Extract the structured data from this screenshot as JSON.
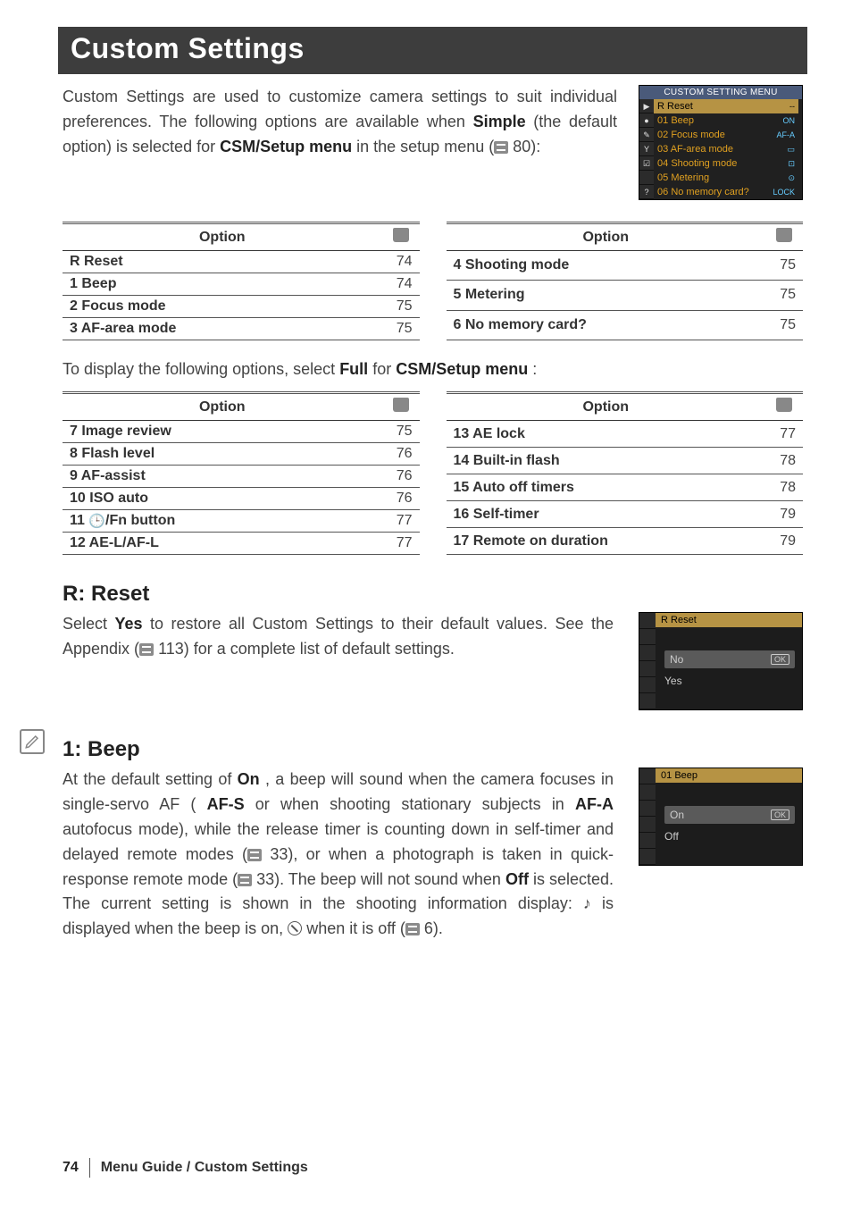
{
  "title": "Custom Settings",
  "intro": {
    "part1": "Custom Settings are used to customize camera settings to suit individual preferences.  The following options are available when ",
    "bold1": "Simple",
    "part2": " (the default option) is selected for ",
    "bold2": "CSM/Setup menu",
    "part3": " in the setup menu (",
    "ref": " 80):"
  },
  "menu_thumb": {
    "header": "CUSTOM SETTING MENU",
    "items": [
      {
        "num": "R",
        "label": "Reset",
        "val": "--",
        "sel": true
      },
      {
        "num": "01",
        "label": "Beep",
        "val": "ON"
      },
      {
        "num": "02",
        "label": "Focus mode",
        "val": "AF-A"
      },
      {
        "num": "03",
        "label": "AF-area mode",
        "val": "▭"
      },
      {
        "num": "04",
        "label": "Shooting mode",
        "val": "⊡"
      },
      {
        "num": "05",
        "label": "Metering",
        "val": "⊙"
      },
      {
        "num": "06",
        "label": "No memory card?",
        "val": "LOCK"
      }
    ]
  },
  "option_header": "Option",
  "table1_left": [
    {
      "name": "R  Reset",
      "page": "74"
    },
    {
      "name": "1  Beep",
      "page": "74"
    },
    {
      "name": "2  Focus mode",
      "page": "75"
    },
    {
      "name": "3  AF-area mode",
      "page": "75"
    }
  ],
  "table1_right": [
    {
      "name": "4  Shooting mode",
      "page": "75"
    },
    {
      "name": "5  Metering",
      "page": "75"
    },
    {
      "name": "6  No memory card?",
      "page": "75"
    }
  ],
  "between": {
    "part1": "To display the following options, select ",
    "bold1": "Full",
    "part2": " for ",
    "bold2": "CSM/Setup menu",
    "part3": ":"
  },
  "table2_left": [
    {
      "name": "7  Image review",
      "page": "75"
    },
    {
      "name": "8  Flash level",
      "page": "76"
    },
    {
      "name": "9  AF-assist",
      "page": "76"
    },
    {
      "name": "10  ISO auto",
      "page": "76"
    },
    {
      "name": "11  ",
      "extra_icon": true,
      "extra_name": "/Fn button",
      "page": "77"
    },
    {
      "name": "12  AE-L/AF-L",
      "page": "77"
    }
  ],
  "table2_right": [
    {
      "name": "13  AE lock",
      "page": "77"
    },
    {
      "name": "14  Built-in flash",
      "page": "78"
    },
    {
      "name": "15   Auto off timers",
      "page": "78"
    },
    {
      "name": "16  Self-timer",
      "page": "79"
    },
    {
      "name": "17  Remote on duration",
      "page": "79"
    }
  ],
  "reset": {
    "head": "R: Reset",
    "part1": "Select ",
    "bold1": "Yes",
    "part2": " to restore all Custom Settings to their default values.  See the Appendix (",
    "ref": " 113) for a complete list of default settings.",
    "thumb_title": "Reset",
    "thumb_prefix": "R",
    "opt1": "No",
    "opt2": "Yes"
  },
  "beep": {
    "head": "1: Beep",
    "part1": "At the default setting of ",
    "bold1": "On",
    "part2": ", a beep will sound when the camera focuses in single-servo AF (",
    "bold2": "AF-S",
    "part3": " or when shooting stationary subjects in ",
    "bold3": "AF-A",
    "part4": " autofocus mode), while the release timer is counting down in self-timer and delayed remote modes (",
    "ref1": " 33), or when a photograph is taken in quick-response remote mode (",
    "ref2": " 33).  The beep will not sound when ",
    "bold4": "Off",
    "part5": " is selected.  The current setting is shown in the shooting information display:  ",
    "note": "♪",
    "part6": " is displayed when the beep is on, ",
    "part7": "  when it is off (",
    "ref3": " 6).",
    "thumb_title": "Beep",
    "thumb_prefix": "01",
    "opt1": "On",
    "opt2": "Off"
  },
  "footer": {
    "page": "74",
    "breadcrumb": "Menu Guide / Custom Settings"
  }
}
